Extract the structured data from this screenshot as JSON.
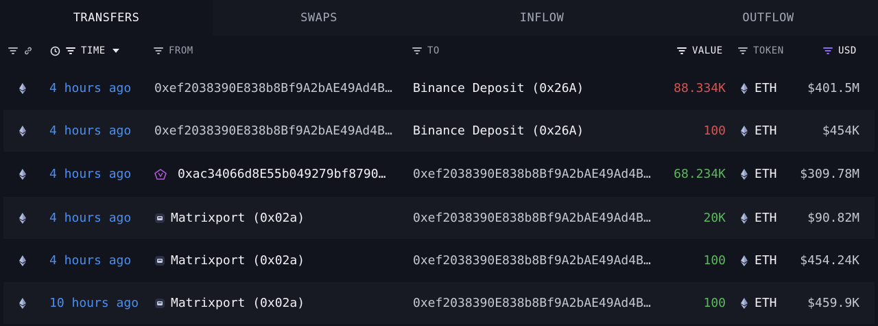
{
  "tabs": [
    {
      "label": "TRANSFERS",
      "active": true
    },
    {
      "label": "SWAPS",
      "active": false
    },
    {
      "label": "INFLOW",
      "active": false
    },
    {
      "label": "OUTFLOW",
      "active": false
    }
  ],
  "columns": {
    "time": "TIME",
    "from": "FROM",
    "to": "TO",
    "value": "VALUE",
    "token": "TOKEN",
    "usd": "USD"
  },
  "colors": {
    "time_link": "#4a8ff0",
    "value_negative": "#d9534f",
    "value_positive": "#5cb85c",
    "usd_filter_active": "#8b6cf0"
  },
  "rows": [
    {
      "time": "4 hours ago",
      "from": "0xef2038390E838b8Bf9A2bAE49Ad4B…",
      "from_icon": "",
      "to": "Binance Deposit (0x26A)",
      "to_is_entity": true,
      "value": "88.334K",
      "value_color": "red",
      "token": "ETH",
      "usd": "$401.5M"
    },
    {
      "time": "4 hours ago",
      "from": "0xef2038390E838b8Bf9A2bAE49Ad4B…",
      "from_icon": "",
      "to": "Binance Deposit (0x26A)",
      "to_is_entity": true,
      "value": "100",
      "value_color": "red",
      "token": "ETH",
      "usd": "$454K"
    },
    {
      "time": "4 hours ago",
      "from": "0xac34066d8E55b049279bf8790…",
      "from_icon": "pentagon-icon",
      "to": "0xef2038390E838b8Bf9A2bAE49Ad4B…",
      "to_is_entity": false,
      "value": "68.234K",
      "value_color": "green",
      "token": "ETH",
      "usd": "$309.78M"
    },
    {
      "time": "4 hours ago",
      "from": "Matrixport (0x02a)",
      "from_icon": "matrixport-icon",
      "to": "0xef2038390E838b8Bf9A2bAE49Ad4B…",
      "to_is_entity": false,
      "value": "20K",
      "value_color": "green",
      "token": "ETH",
      "usd": "$90.82M"
    },
    {
      "time": "4 hours ago",
      "from": "Matrixport (0x02a)",
      "from_icon": "matrixport-icon",
      "to": "0xef2038390E838b8Bf9A2bAE49Ad4B…",
      "to_is_entity": false,
      "value": "100",
      "value_color": "green",
      "token": "ETH",
      "usd": "$454.24K"
    },
    {
      "time": "10 hours ago",
      "from": "Matrixport (0x02a)",
      "from_icon": "matrixport-icon",
      "to": "0xef2038390E838b8Bf9A2bAE49Ad4B…",
      "to_is_entity": false,
      "value": "100",
      "value_color": "green",
      "token": "ETH",
      "usd": "$459.9K"
    }
  ]
}
